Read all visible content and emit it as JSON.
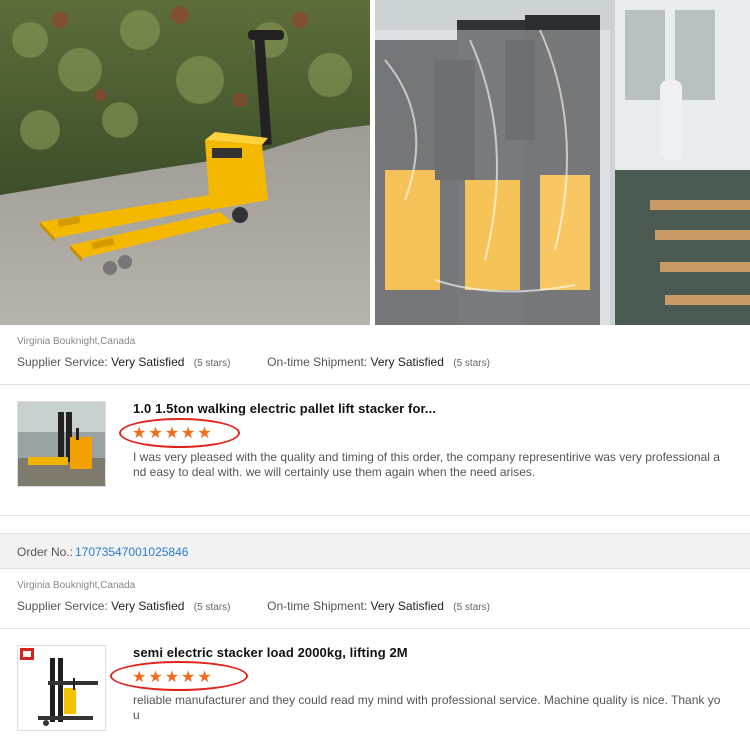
{
  "review1": {
    "reviewer": "Virginia Bouknight,Canada",
    "supplier_label": "Supplier Service:",
    "supplier_value": "Very Satisfied",
    "supplier_stars": "(5 stars)",
    "shipment_label": "On-time Shipment:",
    "shipment_value": "Very Satisfied",
    "shipment_stars": "(5 stars)",
    "product_title": "1.0 1.5ton walking electric pallet lift stacker for...",
    "rating": "★★★★★",
    "comment": "I was very pleased with the quality and timing of this order, the company representirive was very professional and easy to deal with.  we will certainly use them again when the need arises."
  },
  "order": {
    "label": "Order No.:",
    "number": "1707354700102584​6"
  },
  "review2": {
    "reviewer": "Virginia Bouknight,Canada",
    "supplier_label": "Supplier Service:",
    "supplier_value": "Very Satisfied",
    "supplier_stars": "(5 stars)",
    "shipment_label": "On-time Shipment:",
    "shipment_value": "Very Satisfied",
    "shipment_stars": "(5 stars)",
    "product_title": "semi electric stacker load 2000kg, lifting 2M",
    "rating": "★★★★★",
    "comment": "reliable manufacturer and they could read my mind with professional service. Machine quality is nice. Thank you"
  },
  "colors": {
    "star": "#f26c1c",
    "oval": "#e0231b",
    "order_number": "#2a7ccf",
    "forklift_yellow": "#f5b800"
  },
  "icons": {
    "brand_logo": "red-square-logo"
  }
}
